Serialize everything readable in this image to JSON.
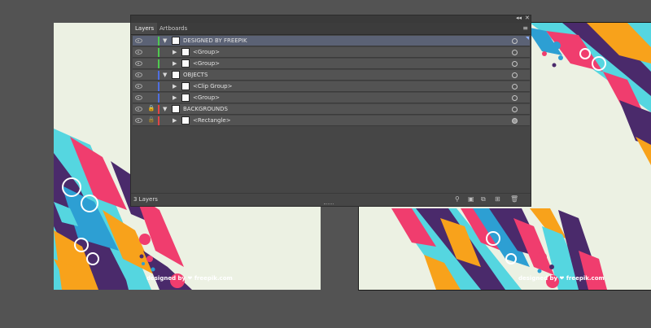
{
  "panel": {
    "controls": {
      "collapse": "◂◂",
      "close": "✕"
    },
    "tabs": [
      {
        "label": "Layers",
        "active": true
      },
      {
        "label": "Artboards",
        "active": false
      }
    ],
    "menu_icon": "panel-menu-icon",
    "layers": [
      {
        "label": "DESIGNED BY FREEPIK",
        "level": 0,
        "expanded": true,
        "color": "#4fc94f",
        "locked": false,
        "selected": true
      },
      {
        "label": "<Group>",
        "level": 1,
        "expanded": false,
        "color": "#4fc94f",
        "locked": false
      },
      {
        "label": "<Group>",
        "level": 1,
        "expanded": false,
        "color": "#4fc94f",
        "locked": false
      },
      {
        "label": "OBJECTS",
        "level": 0,
        "expanded": true,
        "color": "#4f6fe0",
        "locked": false
      },
      {
        "label": "<Clip Group>",
        "level": 1,
        "expanded": false,
        "color": "#4f6fe0",
        "locked": false
      },
      {
        "label": "<Group>",
        "level": 1,
        "expanded": false,
        "color": "#4f6fe0",
        "locked": false
      },
      {
        "label": "BACKGROUNDS",
        "level": 0,
        "expanded": true,
        "color": "#e04646",
        "locked": true
      },
      {
        "label": "<Rectangle>",
        "level": 1,
        "expanded": false,
        "color": "#e04646",
        "locked": true
      }
    ],
    "footer": {
      "count": "3 Layers",
      "icons": [
        "locate-object-icon",
        "make-clipping-mask-icon",
        "create-sublayer-icon",
        "new-layer-icon",
        "delete-icon"
      ]
    }
  },
  "artboards": {
    "left_credit": "designed by ❤ freepik.com",
    "right_credit": "designed by ❤ freepik.com"
  },
  "colors": {
    "workspace": "#535353",
    "artboard": "#ecf1e3",
    "cyan": "#55d6e0",
    "blue": "#2d9fd3",
    "purple": "#4a2a6b",
    "pink": "#f03d6e",
    "orange": "#f8a21b"
  }
}
